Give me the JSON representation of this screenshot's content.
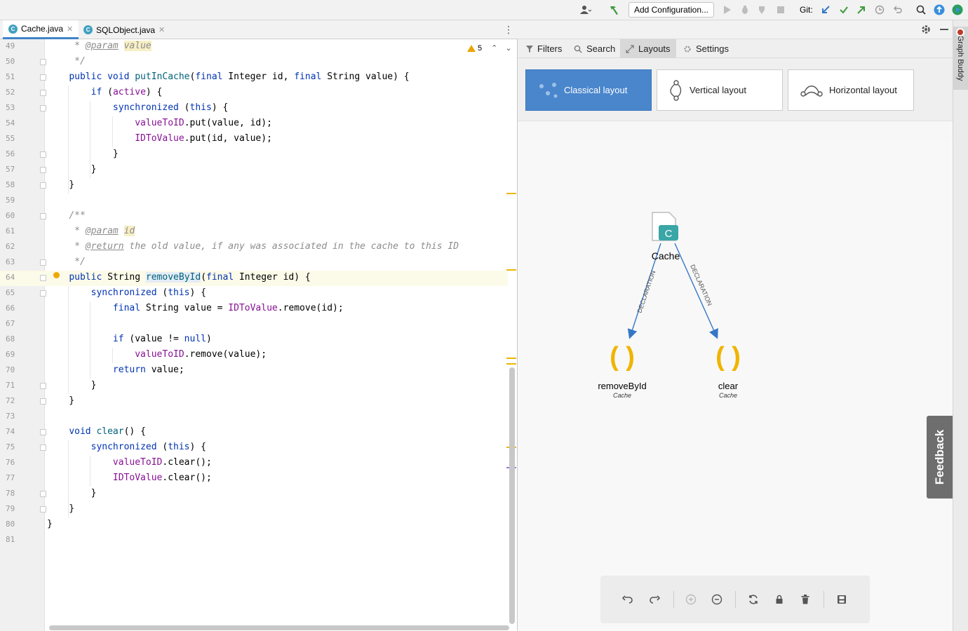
{
  "toolbar": {
    "add_configuration": "Add Configuration...",
    "git_label": "Git:",
    "icons": [
      "user-icon",
      "build-hammer-icon",
      "run-icon",
      "debug-icon",
      "coverage-icon",
      "stop-icon",
      "git-update-icon",
      "git-commit-icon",
      "git-push-icon",
      "history-icon",
      "rollback-icon",
      "search-icon",
      "upload-icon",
      "plugin-icon"
    ]
  },
  "editor": {
    "tabs": [
      {
        "label": "Cache.java",
        "active": true
      },
      {
        "label": "SQLObject.java",
        "active": false
      }
    ],
    "warning_count": "5",
    "current_line": 64
  },
  "graph_buddy": {
    "menu": {
      "filters": "Filters",
      "search": "Search",
      "layouts": "Layouts",
      "settings": "Settings"
    },
    "layouts": {
      "classical": "Classical layout",
      "vertical": "Vertical layout",
      "horizontal": "Horizontal layout"
    },
    "nodes": {
      "cache": {
        "label": "Cache",
        "badge": "C"
      },
      "remove": {
        "label": "removeById",
        "sublabel": "Cache"
      },
      "clear": {
        "label": "clear",
        "sublabel": "Cache"
      }
    },
    "edge_label": "DECLARATION",
    "feedback": "Feedback",
    "strip_title": "Graph Buddy",
    "accent": "#4a86cc",
    "node_teal": "#3aa6a6",
    "method_orange": "#f0b400"
  }
}
